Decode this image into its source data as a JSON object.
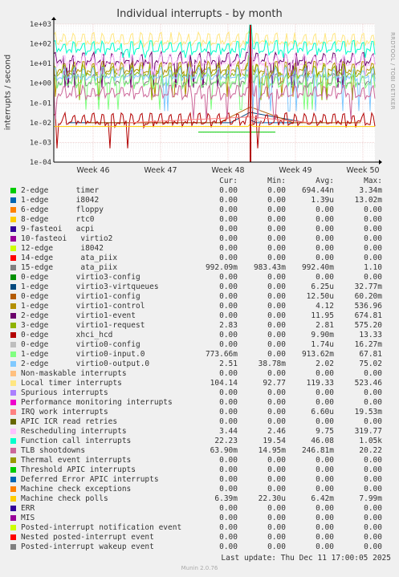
{
  "header": {
    "title": "Individual interrupts - by month",
    "side_text": "RRDTOOL / TOBI OETIKER",
    "footer_update": "Last update: Thu Dec 11 17:00:05 2025",
    "footer_munin": "Munin 2.0.76"
  },
  "chart_data": {
    "type": "line",
    "title": "Individual interrupts - by month",
    "ylabel": "interrupts / second",
    "yscale": "log",
    "ylim": [
      0.0001,
      1000
    ],
    "yticks": [
      "1e-04",
      "1e-03",
      "1e-02",
      "1e-01",
      "1e+00",
      "1e+01",
      "1e+02",
      "1e+03"
    ],
    "xticks": [
      "Week 46",
      "Week 47",
      "Week 48",
      "Week 49",
      "Week 50"
    ],
    "grid": true,
    "columns": [
      "Cur:",
      "Min:",
      "Avg:",
      "Max:"
    ],
    "series": [
      {
        "name": "2-edge      timer",
        "color": "#00cc00",
        "cur": "0.00",
        "min": "0.00",
        "avg": "694.44n",
        "max": "3.34m"
      },
      {
        "name": "1-edge      i8042",
        "color": "#0066b3",
        "cur": "0.00",
        "min": "0.00",
        "avg": "1.39u",
        "max": "13.02m"
      },
      {
        "name": "6-edge      floppy",
        "color": "#ff8000",
        "cur": "0.00",
        "min": "0.00",
        "avg": "0.00",
        "max": "0.00"
      },
      {
        "name": "8-edge      rtc0",
        "color": "#ffcc00",
        "cur": "0.00",
        "min": "0.00",
        "avg": "0.00",
        "max": "0.00"
      },
      {
        "name": "9-fasteoi   acpi",
        "color": "#330099",
        "cur": "0.00",
        "min": "0.00",
        "avg": "0.00",
        "max": "0.00"
      },
      {
        "name": "10-fasteoi   virtio2",
        "color": "#990099",
        "cur": "0.00",
        "min": "0.00",
        "avg": "0.00",
        "max": "0.00"
      },
      {
        "name": "12-edge      i8042",
        "color": "#ccff00",
        "cur": "0.00",
        "min": "0.00",
        "avg": "0.00",
        "max": "0.00"
      },
      {
        "name": "14-edge      ata_piix",
        "color": "#ff0000",
        "cur": "0.00",
        "min": "0.00",
        "avg": "0.00",
        "max": "0.00"
      },
      {
        "name": "15-edge      ata_piix",
        "color": "#808080",
        "cur": "992.09m",
        "min": "983.43m",
        "avg": "992.40m",
        "max": "1.10"
      },
      {
        "name": "0-edge      virtio3-config",
        "color": "#008f00",
        "cur": "0.00",
        "min": "0.00",
        "avg": "0.00",
        "max": "0.00"
      },
      {
        "name": "1-edge      virtio3-virtqueues",
        "color": "#00487d",
        "cur": "0.00",
        "min": "0.00",
        "avg": "6.25u",
        "max": "32.77m"
      },
      {
        "name": "0-edge      virtio1-config",
        "color": "#b35a00",
        "cur": "0.00",
        "min": "0.00",
        "avg": "12.50u",
        "max": "60.20m"
      },
      {
        "name": "1-edge      virtio1-control",
        "color": "#b38f00",
        "cur": "0.00",
        "min": "0.00",
        "avg": "4.12",
        "max": "536.96"
      },
      {
        "name": "2-edge      virtio1-event",
        "color": "#6b006b",
        "cur": "0.00",
        "min": "0.00",
        "avg": "11.95",
        "max": "674.81"
      },
      {
        "name": "3-edge      virtio1-request",
        "color": "#8fb300",
        "cur": "2.83",
        "min": "0.00",
        "avg": "2.81",
        "max": "575.20"
      },
      {
        "name": "0-edge      xhci_hcd",
        "color": "#b30000",
        "cur": "0.00",
        "min": "0.00",
        "avg": "9.90m",
        "max": "13.33"
      },
      {
        "name": "0-edge      virtio0-config",
        "color": "#bebebe",
        "cur": "0.00",
        "min": "0.00",
        "avg": "1.74u",
        "max": "16.27m"
      },
      {
        "name": "1-edge      virtio0-input.0",
        "color": "#80ff80",
        "cur": "773.66m",
        "min": "0.00",
        "avg": "913.62m",
        "max": "67.81"
      },
      {
        "name": "2-edge      virtio0-output.0",
        "color": "#80c9ff",
        "cur": "2.51",
        "min": "38.78m",
        "avg": "2.02",
        "max": "75.02"
      },
      {
        "name": "Non-maskable interrupts",
        "color": "#ffc080",
        "cur": "0.00",
        "min": "0.00",
        "avg": "0.00",
        "max": "0.00"
      },
      {
        "name": "Local timer interrupts",
        "color": "#ffe680",
        "cur": "104.14",
        "min": "92.77",
        "avg": "119.33",
        "max": "523.46"
      },
      {
        "name": "Spurious interrupts",
        "color": "#aa80ff",
        "cur": "0.00",
        "min": "0.00",
        "avg": "0.00",
        "max": "0.00"
      },
      {
        "name": "Performance monitoring interrupts",
        "color": "#ee00cc",
        "cur": "0.00",
        "min": "0.00",
        "avg": "0.00",
        "max": "0.00"
      },
      {
        "name": "IRQ work interrupts",
        "color": "#ff8080",
        "cur": "0.00",
        "min": "0.00",
        "avg": "6.60u",
        "max": "19.53m"
      },
      {
        "name": "APIC ICR read retries",
        "color": "#666600",
        "cur": "0.00",
        "min": "0.00",
        "avg": "0.00",
        "max": "0.00"
      },
      {
        "name": "Rescheduling interrupts",
        "color": "#ffbfff",
        "cur": "3.44",
        "min": "2.46",
        "avg": "9.75",
        "max": "319.77"
      },
      {
        "name": "Function call interrupts",
        "color": "#00ffcc",
        "cur": "22.23",
        "min": "19.54",
        "avg": "46.08",
        "max": "1.05k"
      },
      {
        "name": "TLB shootdowns",
        "color": "#cc6699",
        "cur": "63.90m",
        "min": "14.95m",
        "avg": "246.81m",
        "max": "20.22"
      },
      {
        "name": "Thermal event interrupts",
        "color": "#999900",
        "cur": "0.00",
        "min": "0.00",
        "avg": "0.00",
        "max": "0.00"
      },
      {
        "name": "Threshold APIC interrupts",
        "color": "#00cc00",
        "cur": "0.00",
        "min": "0.00",
        "avg": "0.00",
        "max": "0.00"
      },
      {
        "name": "Deferred Error APIC interrupts",
        "color": "#0066b3",
        "cur": "0.00",
        "min": "0.00",
        "avg": "0.00",
        "max": "0.00"
      },
      {
        "name": "Machine check exceptions",
        "color": "#ff8000",
        "cur": "0.00",
        "min": "0.00",
        "avg": "0.00",
        "max": "0.00"
      },
      {
        "name": "Machine check polls",
        "color": "#ffcc00",
        "cur": "6.39m",
        "min": "22.30u",
        "avg": "6.42m",
        "max": "7.99m"
      },
      {
        "name": "ERR",
        "color": "#330099",
        "cur": "0.00",
        "min": "0.00",
        "avg": "0.00",
        "max": "0.00"
      },
      {
        "name": "MIS",
        "color": "#990099",
        "cur": "0.00",
        "min": "0.00",
        "avg": "0.00",
        "max": "0.00"
      },
      {
        "name": "Posted-interrupt notification event",
        "color": "#ccff00",
        "cur": "0.00",
        "min": "0.00",
        "avg": "0.00",
        "max": "0.00"
      },
      {
        "name": "Nested posted-interrupt event",
        "color": "#ff0000",
        "cur": "0.00",
        "min": "0.00",
        "avg": "0.00",
        "max": "0.00"
      },
      {
        "name": "Posted-interrupt wakeup event",
        "color": "#808080",
        "cur": "0.00",
        "min": "0.00",
        "avg": "0.00",
        "max": "0.00"
      }
    ]
  }
}
